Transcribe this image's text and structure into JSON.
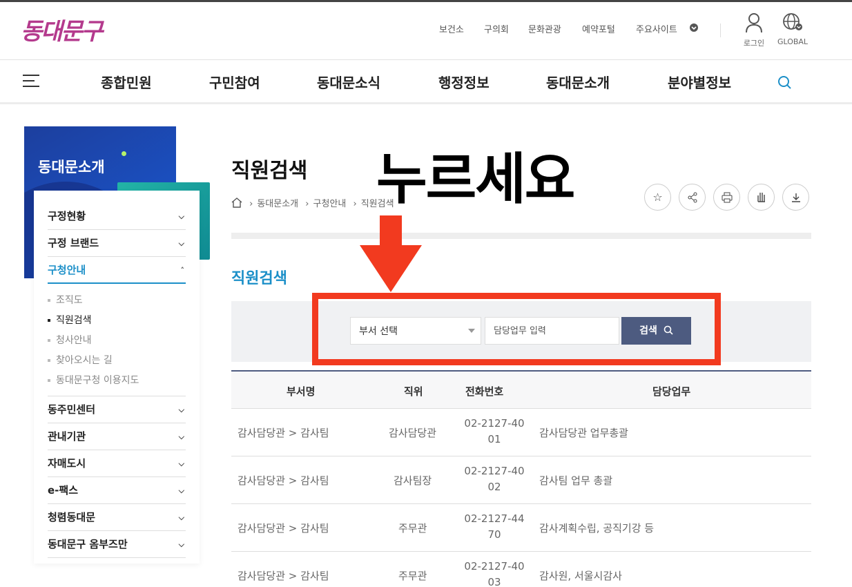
{
  "header": {
    "logo": "동대문구",
    "util_links": [
      "보건소",
      "구의회",
      "문화관광",
      "예약포털",
      "주요사이트"
    ],
    "login_label": "로그인",
    "global_label": "GLOBAL"
  },
  "gnb": {
    "items": [
      "종합민원",
      "구민참여",
      "동대문소식",
      "행정정보",
      "동대문소개",
      "분야별정보"
    ]
  },
  "side": {
    "title": "동대문소개",
    "items": [
      {
        "label": "구정현황"
      },
      {
        "label": "구정 브랜드"
      },
      {
        "label": "구청안내"
      },
      {
        "label": "동주민센터"
      },
      {
        "label": "관내기관"
      },
      {
        "label": "자매도시"
      },
      {
        "label": "e-팩스"
      },
      {
        "label": "청렴동대문"
      },
      {
        "label": "동대문구 옴부즈만"
      }
    ],
    "sub_items": [
      "조직도",
      "직원검색",
      "청사안내",
      "찾아오시는 길",
      "동대문구청 이용지도"
    ]
  },
  "content": {
    "page_title": "직원검색",
    "breadcrumb": [
      "동대문소개",
      "구청안내",
      "직원검색"
    ],
    "section_title": "직원검색",
    "search": {
      "dept_select": "부서 선택",
      "duty_placeholder": "담당업무 입력",
      "button_label": "검색"
    }
  },
  "table": {
    "headers": [
      "부서명",
      "직위",
      "전화번호",
      "담당업무"
    ],
    "rows": [
      {
        "dept": "감사담당관 > 감사팀",
        "position": "감사담당관",
        "phone1": "02-2127-40",
        "phone2": "01",
        "duty": "감사담당관 업무총괄"
      },
      {
        "dept": "감사담당관 > 감사팀",
        "position": "감사팀장",
        "phone1": "02-2127-40",
        "phone2": "02",
        "duty": "감사팀 업무 총괄"
      },
      {
        "dept": "감사담당관 > 감사팀",
        "position": "주무관",
        "phone1": "02-2127-44",
        "phone2": "70",
        "duty": "감사계획수립, 공직기강 등"
      },
      {
        "dept": "감사담당관 > 감사팀",
        "position": "주무관",
        "phone1": "02-2127-40",
        "phone2": "03",
        "duty": "감사원, 서울시감사"
      }
    ]
  },
  "annotation": {
    "text": "누르세요",
    "color": "#f23a1f"
  }
}
